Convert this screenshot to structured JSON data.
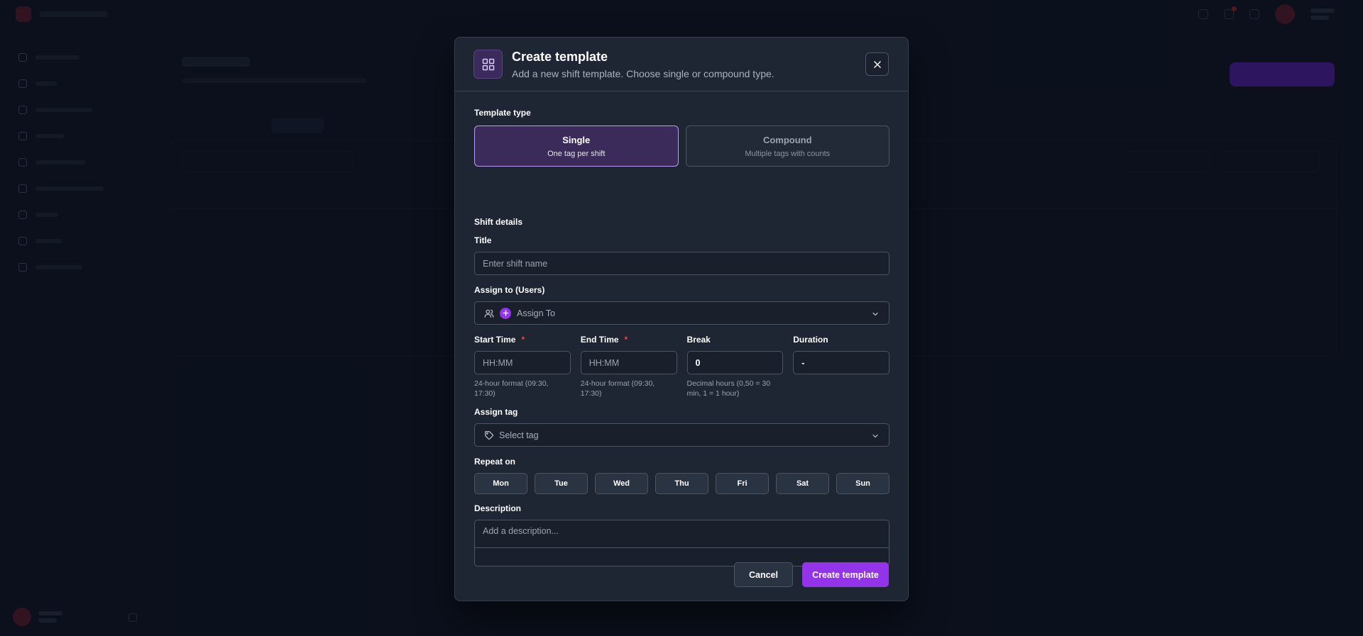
{
  "background": {
    "sidebar_item_count": 9
  },
  "modal": {
    "title": "Create template",
    "subtitle": "Add a new shift template. Choose single or compound type.",
    "header_icon": "layout-grid-icon",
    "close_icon": "close-icon"
  },
  "template_type": {
    "label": "Template type",
    "options": [
      {
        "name": "Single",
        "description": "One tag per shift",
        "selected": true
      },
      {
        "name": "Compound",
        "description": "Multiple tags with counts",
        "selected": false
      }
    ]
  },
  "shift_details": {
    "section_label": "Shift details",
    "title_label": "Title",
    "title_placeholder": "Enter shift name",
    "title_value": "",
    "assign_users_label": "Assign to (Users)",
    "assign_users_placeholder": "Assign To",
    "start_time": {
      "label": "Start Time",
      "required": "*",
      "placeholder": "HH:MM",
      "hint": "24-hour format (09:30, 17:30)"
    },
    "end_time": {
      "label": "End Time",
      "required": "*",
      "placeholder": "HH:MM",
      "hint": "24-hour format (09:30, 17:30)"
    },
    "break": {
      "label": "Break",
      "value": "0",
      "hint": "Decimal hours (0,50 = 30 min, 1 = 1 hour)"
    },
    "duration": {
      "label": "Duration",
      "value": "-"
    },
    "assign_tag_label": "Assign tag",
    "assign_tag_placeholder": "Select tag",
    "repeat_label": "Repeat on",
    "days": [
      "Mon",
      "Tue",
      "Wed",
      "Thu",
      "Fri",
      "Sat",
      "Sun"
    ],
    "description_label": "Description",
    "description_placeholder": "Add a description..."
  },
  "footer": {
    "cancel_label": "Cancel",
    "create_label": "Create template"
  },
  "colors": {
    "accent": "#9333ea",
    "selected_card_bg": "#3b2b5a",
    "selected_card_border": "#b79ef5",
    "required": "#ef4444"
  }
}
